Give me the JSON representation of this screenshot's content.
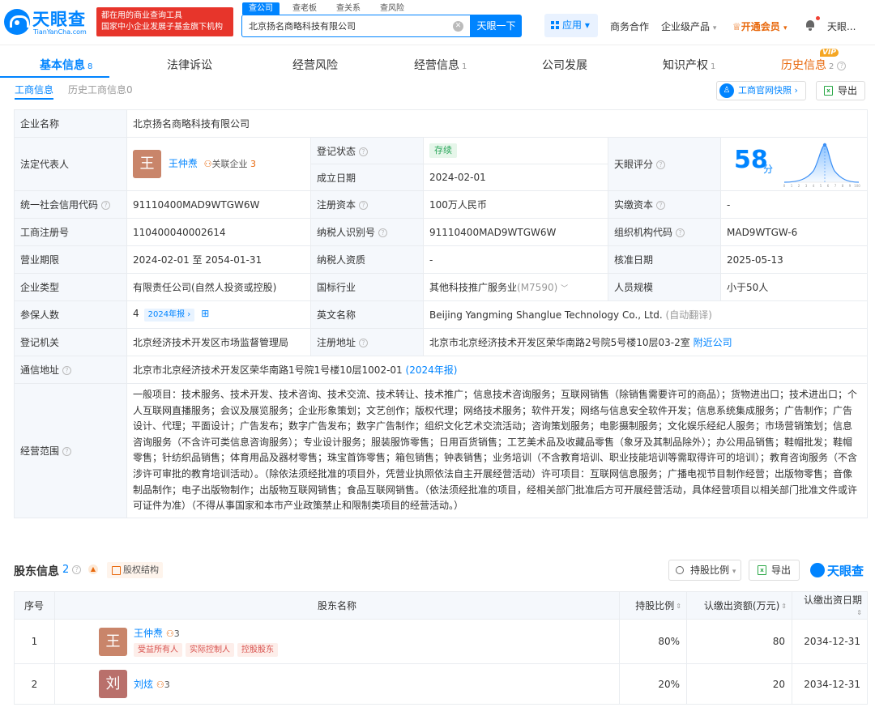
{
  "header": {
    "logo_cn": "天眼查",
    "logo_en": "TianYanCha.com",
    "slogan_line1": "都在用的商业查询工具",
    "slogan_line2": "国家中小企业发展子基金旗下机构",
    "search_tabs": [
      "查公司",
      "查老板",
      "查关系",
      "查风险"
    ],
    "search_value": "北京扬名商略科技有限公司",
    "search_button": "天眼一下",
    "apps": "应用",
    "biz": "商务合作",
    "enterprise": "企业级产品",
    "vip": "开通会员",
    "user": "天眼..."
  },
  "tabs": [
    {
      "label": "基本信息",
      "count": "8"
    },
    {
      "label": "法律诉讼",
      "count": ""
    },
    {
      "label": "经营风险",
      "count": ""
    },
    {
      "label": "经营信息",
      "count": "1"
    },
    {
      "label": "公司发展",
      "count": ""
    },
    {
      "label": "知识产权",
      "count": "1"
    },
    {
      "label": "历史信息",
      "count": "2"
    }
  ],
  "vip_badge": "VIP",
  "subtabs": {
    "active": "工商信息",
    "other": "历史工商信息0"
  },
  "actions": {
    "official_snapshot": "工商官网快照",
    "export": "导出"
  },
  "info": {
    "company_name_label": "企业名称",
    "company_name": "北京扬名商略科技有限公司",
    "legal_rep_label": "法定代表人",
    "legal_rep_avatar": "王",
    "legal_rep": "王仲焘",
    "related_label": "关联企业",
    "related_count": "3",
    "reg_status_label": "登记状态",
    "reg_status": "存续",
    "found_date_label": "成立日期",
    "found_date": "2024-02-01",
    "score_label": "天眼评分",
    "score": "58",
    "score_unit": "分",
    "credit_code_label": "统一社会信用代码",
    "credit_code": "91110400MAD9WTGW6W",
    "reg_capital_label": "注册资本",
    "reg_capital": "100万人民币",
    "paid_capital_label": "实缴资本",
    "paid_capital": "-",
    "reg_no_label": "工商注册号",
    "reg_no": "110400040002614",
    "taxpayer_id_label": "纳税人识别号",
    "taxpayer_id": "91110400MAD9WTGW6W",
    "org_code_label": "组织机构代码",
    "org_code": "MAD9WTGW-6",
    "term_label": "营业期限",
    "term": "2024-02-01 至 2054-01-31",
    "taxpayer_qual_label": "纳税人资质",
    "taxpayer_qual": "-",
    "approve_date_label": "核准日期",
    "approve_date": "2025-05-13",
    "type_label": "企业类型",
    "type": "有限责任公司(自然人投资或控股)",
    "industry_label": "国标行业",
    "industry": "其他科技推广服务业",
    "industry_code": "(M7590)",
    "staff_label": "人员规模",
    "staff": "小于50人",
    "insured_label": "参保人数",
    "insured": "4",
    "insured_report": "2024年报",
    "en_name_label": "英文名称",
    "en_name": "Beijing Yangming Shanglue Technology Co., Ltd.",
    "en_name_note": "(自动翻译)",
    "authority_label": "登记机关",
    "authority": "北京经济技术开发区市场监督管理局",
    "reg_addr_label": "注册地址",
    "reg_addr": "北京市北京经济技术开发区荣华南路2号院5号楼10层03-2室",
    "nearby": "附近公司",
    "mail_addr_label": "通信地址",
    "mail_addr": "北京市北京经济技术开发区荣华南路1号院1号楼10层1002-01",
    "mail_addr_note": "(2024年报)",
    "scope_label": "经营范围",
    "scope": "一般项目：技术服务、技术开发、技术咨询、技术交流、技术转让、技术推广；信息技术咨询服务；互联网销售（除销售需要许可的商品）；货物进出口；技术进出口；个人互联网直播服务；会议及展览服务；企业形象策划；文艺创作；版权代理；网络技术服务；软件开发；网络与信息安全软件开发；信息系统集成服务；广告制作；广告设计、代理；平面设计；广告发布；数字广告发布；数字广告制作；组织文化艺术交流活动；咨询策划服务；电影摄制服务；文化娱乐经纪人服务；市场营销策划；信息咨询服务（不含许可类信息咨询服务）；专业设计服务；服装服饰零售；日用百货销售；工艺美术品及收藏品零售（象牙及其制品除外）；办公用品销售；鞋帽批发；鞋帽零售；针纺织品销售；体育用品及器材零售；珠宝首饰零售；箱包销售；钟表销售；业务培训（不含教育培训、职业技能培训等需取得许可的培训）；教育咨询服务（不含涉许可审批的教育培训活动）。（除依法须经批准的项目外，凭营业执照依法自主开展经营活动）许可项目：互联网信息服务；广播电视节目制作经营；出版物零售；音像制品制作；电子出版物制作；出版物互联网销售；食品互联网销售。（依法须经批准的项目，经相关部门批准后方可开展经营活动，具体经营项目以相关部门批准文件或许可证件为准）（不得从事国家和本市产业政策禁止和限制类项目的经营活动。）"
  },
  "score_chart_ticks": [
    "0",
    "1",
    "2",
    "3",
    "4",
    "5",
    "6",
    "7",
    "8",
    "9",
    "100"
  ],
  "shareholders": {
    "title": "股东信息",
    "count": "2",
    "structure": "股权结构",
    "ratio_btn": "持股比例",
    "export": "导出",
    "logo": "天眼查",
    "columns": [
      "序号",
      "股东名称",
      "持股比例",
      "认缴出资额(万元)",
      "认缴出资日期"
    ],
    "rows": [
      {
        "no": "1",
        "avatar": "王",
        "name": "王仲焘",
        "links": "3",
        "roles": [
          "受益所有人",
          "实际控制人",
          "控股股东"
        ],
        "ratio": "80%",
        "amount": "80",
        "date": "2034-12-31"
      },
      {
        "no": "2",
        "avatar": "刘",
        "name": "刘炫",
        "links": "3",
        "roles": [],
        "ratio": "20%",
        "amount": "20",
        "date": "2034-12-31"
      }
    ]
  },
  "colors": {
    "brand": "#0084ff",
    "accent": "#e8680c",
    "status_green": "#29a65a",
    "slogan_red": "#e7352b"
  }
}
